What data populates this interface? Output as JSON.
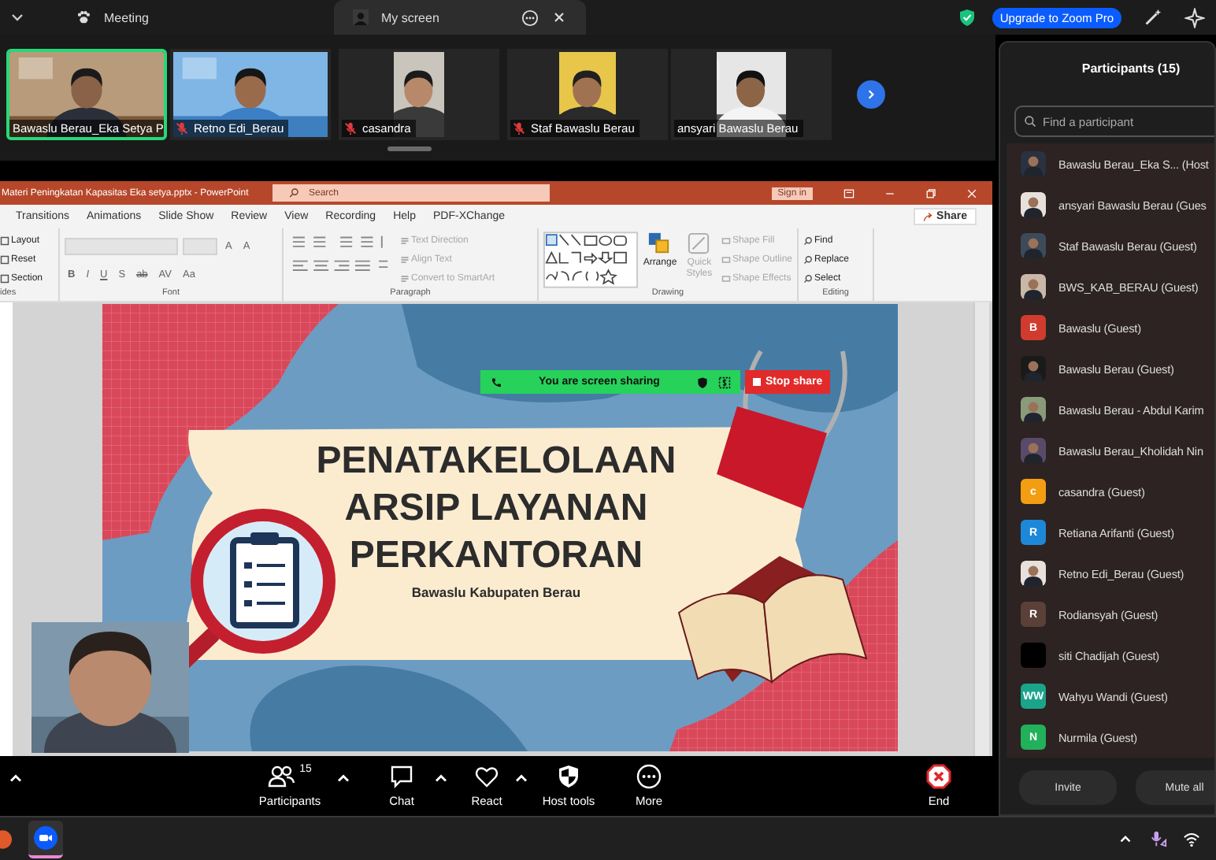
{
  "top_bar": {
    "tabs": [
      {
        "label": "Meeting",
        "selected": false,
        "kind": "meeting"
      },
      {
        "label": "My screen",
        "selected": true,
        "kind": "screen"
      }
    ],
    "upgrade_button": "Upgrade to Zoom Pro"
  },
  "video_strip": {
    "tiles": [
      {
        "name": "Bawaslu Berau_Eka Setya P",
        "muted": false,
        "speaking": true
      },
      {
        "name": "Retno Edi_Berau",
        "muted": true,
        "speaking": false
      },
      {
        "name": "casandra",
        "muted": true,
        "speaking": false
      },
      {
        "name": "Staf Bawaslu Berau",
        "muted": true,
        "speaking": false
      },
      {
        "name": "ansyari Bawaslu Berau",
        "muted": false,
        "speaking": false
      }
    ]
  },
  "powerpoint": {
    "title": "Materi Peningkatan Kapasitas Eka setya.pptx  -  PowerPoint",
    "search": {
      "placeholder": "Search"
    },
    "sign_in": "Sign in",
    "menu": [
      "Transitions",
      "Animations",
      "Slide Show",
      "Review",
      "View",
      "Recording",
      "Help",
      "PDF-XChange"
    ],
    "share": "Share",
    "ribbon": [
      {
        "kind": "slides",
        "label": "ides",
        "items": [
          {
            "label": "Layout",
            "disabled": false
          },
          {
            "label": "Reset",
            "disabled": false
          },
          {
            "label": "Section",
            "disabled": false
          }
        ]
      },
      {
        "kind": "font",
        "label": "Font",
        "size_buttons": [
          "A",
          "A"
        ],
        "buttons": [
          "B",
          "I",
          "U",
          "S",
          "ab",
          "AV",
          "Aa"
        ]
      },
      {
        "kind": "paragraph",
        "label": "Paragraph",
        "items": [
          {
            "label": "Text Direction",
            "disabled": true
          },
          {
            "label": "Align Text",
            "disabled": true
          },
          {
            "label": "Convert to SmartArt",
            "disabled": true
          }
        ]
      },
      {
        "kind": "drawing",
        "label": "Drawing",
        "items": [
          {
            "label": "Arrange",
            "disabled": false
          },
          {
            "label": "Quick Styles",
            "disabled": true
          },
          {
            "label": "Shape Fill",
            "disabled": true
          },
          {
            "label": "Shape Outline",
            "disabled": true
          },
          {
            "label": "Shape Effects",
            "disabled": true
          }
        ]
      },
      {
        "kind": "editing",
        "label": "Editing",
        "items": [
          {
            "label": "Find",
            "disabled": false
          },
          {
            "label": "Replace",
            "disabled": false
          },
          {
            "label": "Select",
            "disabled": false
          }
        ]
      }
    ],
    "slide": {
      "title_lines": [
        "PENATAKELOLAAN",
        "ARSIP LAYANAN",
        "PERKANTORAN"
      ],
      "subtitle": "Bawaslu Kabupaten Berau"
    }
  },
  "sharing_bar": {
    "status": "You are screen sharing",
    "stop_button": "Stop share"
  },
  "participants_panel": {
    "title": "Participants (15)",
    "search": {
      "placeholder": "Find a participant"
    },
    "participants": [
      {
        "name": "Bawaslu Berau_Eka S... (Host"
      },
      {
        "name": "ansyari Bawaslu Berau (Gues"
      },
      {
        "name": "Staf Bawaslu Berau (Guest)"
      },
      {
        "name": "BWS_KAB_BERAU (Guest)"
      },
      {
        "name": "Bawaslu (Guest)",
        "kind": "letter",
        "letter": "B",
        "color": "#d13b2f"
      },
      {
        "name": "Bawaslu Berau (Guest)"
      },
      {
        "name": "Bawaslu Berau - Abdul Karim"
      },
      {
        "name": "Bawaslu Berau_Kholidah Nin"
      },
      {
        "name": "casandra (Guest)",
        "kind": "letter",
        "letter": "c",
        "color": "#f29d12"
      },
      {
        "name": "Retiana Arifanti (Guest)",
        "kind": "letter",
        "letter": "R",
        "color": "#1e88d8"
      },
      {
        "name": "Retno Edi_Berau (Guest)"
      },
      {
        "name": "Rodiansyah (Guest)",
        "kind": "letter",
        "letter": "R",
        "color": "#5a4038"
      },
      {
        "name": "siti Chadijah (Guest)",
        "kind": "blank",
        "color": "#000000"
      },
      {
        "name": "Wahyu Wandi (Guest)",
        "kind": "letter",
        "letter": "WW",
        "color": "#1aa58a"
      },
      {
        "name": "Nurmila (Guest)",
        "kind": "letter",
        "letter": "N",
        "color": "#22b05a"
      }
    ],
    "buttons": [
      "Invite",
      "Mute all"
    ]
  },
  "toolbar": [
    {
      "kind": "caret"
    },
    {
      "kind": "participants",
      "label": "Participants",
      "count": "15",
      "caret": true
    },
    {
      "kind": "chat",
      "label": "Chat",
      "caret": true
    },
    {
      "kind": "react",
      "label": "React",
      "caret": true
    },
    {
      "kind": "host-tools",
      "label": "Host tools",
      "caret": false
    },
    {
      "kind": "more",
      "label": "More",
      "caret": false
    },
    {
      "kind": "end",
      "label": "End",
      "caret": false
    }
  ]
}
